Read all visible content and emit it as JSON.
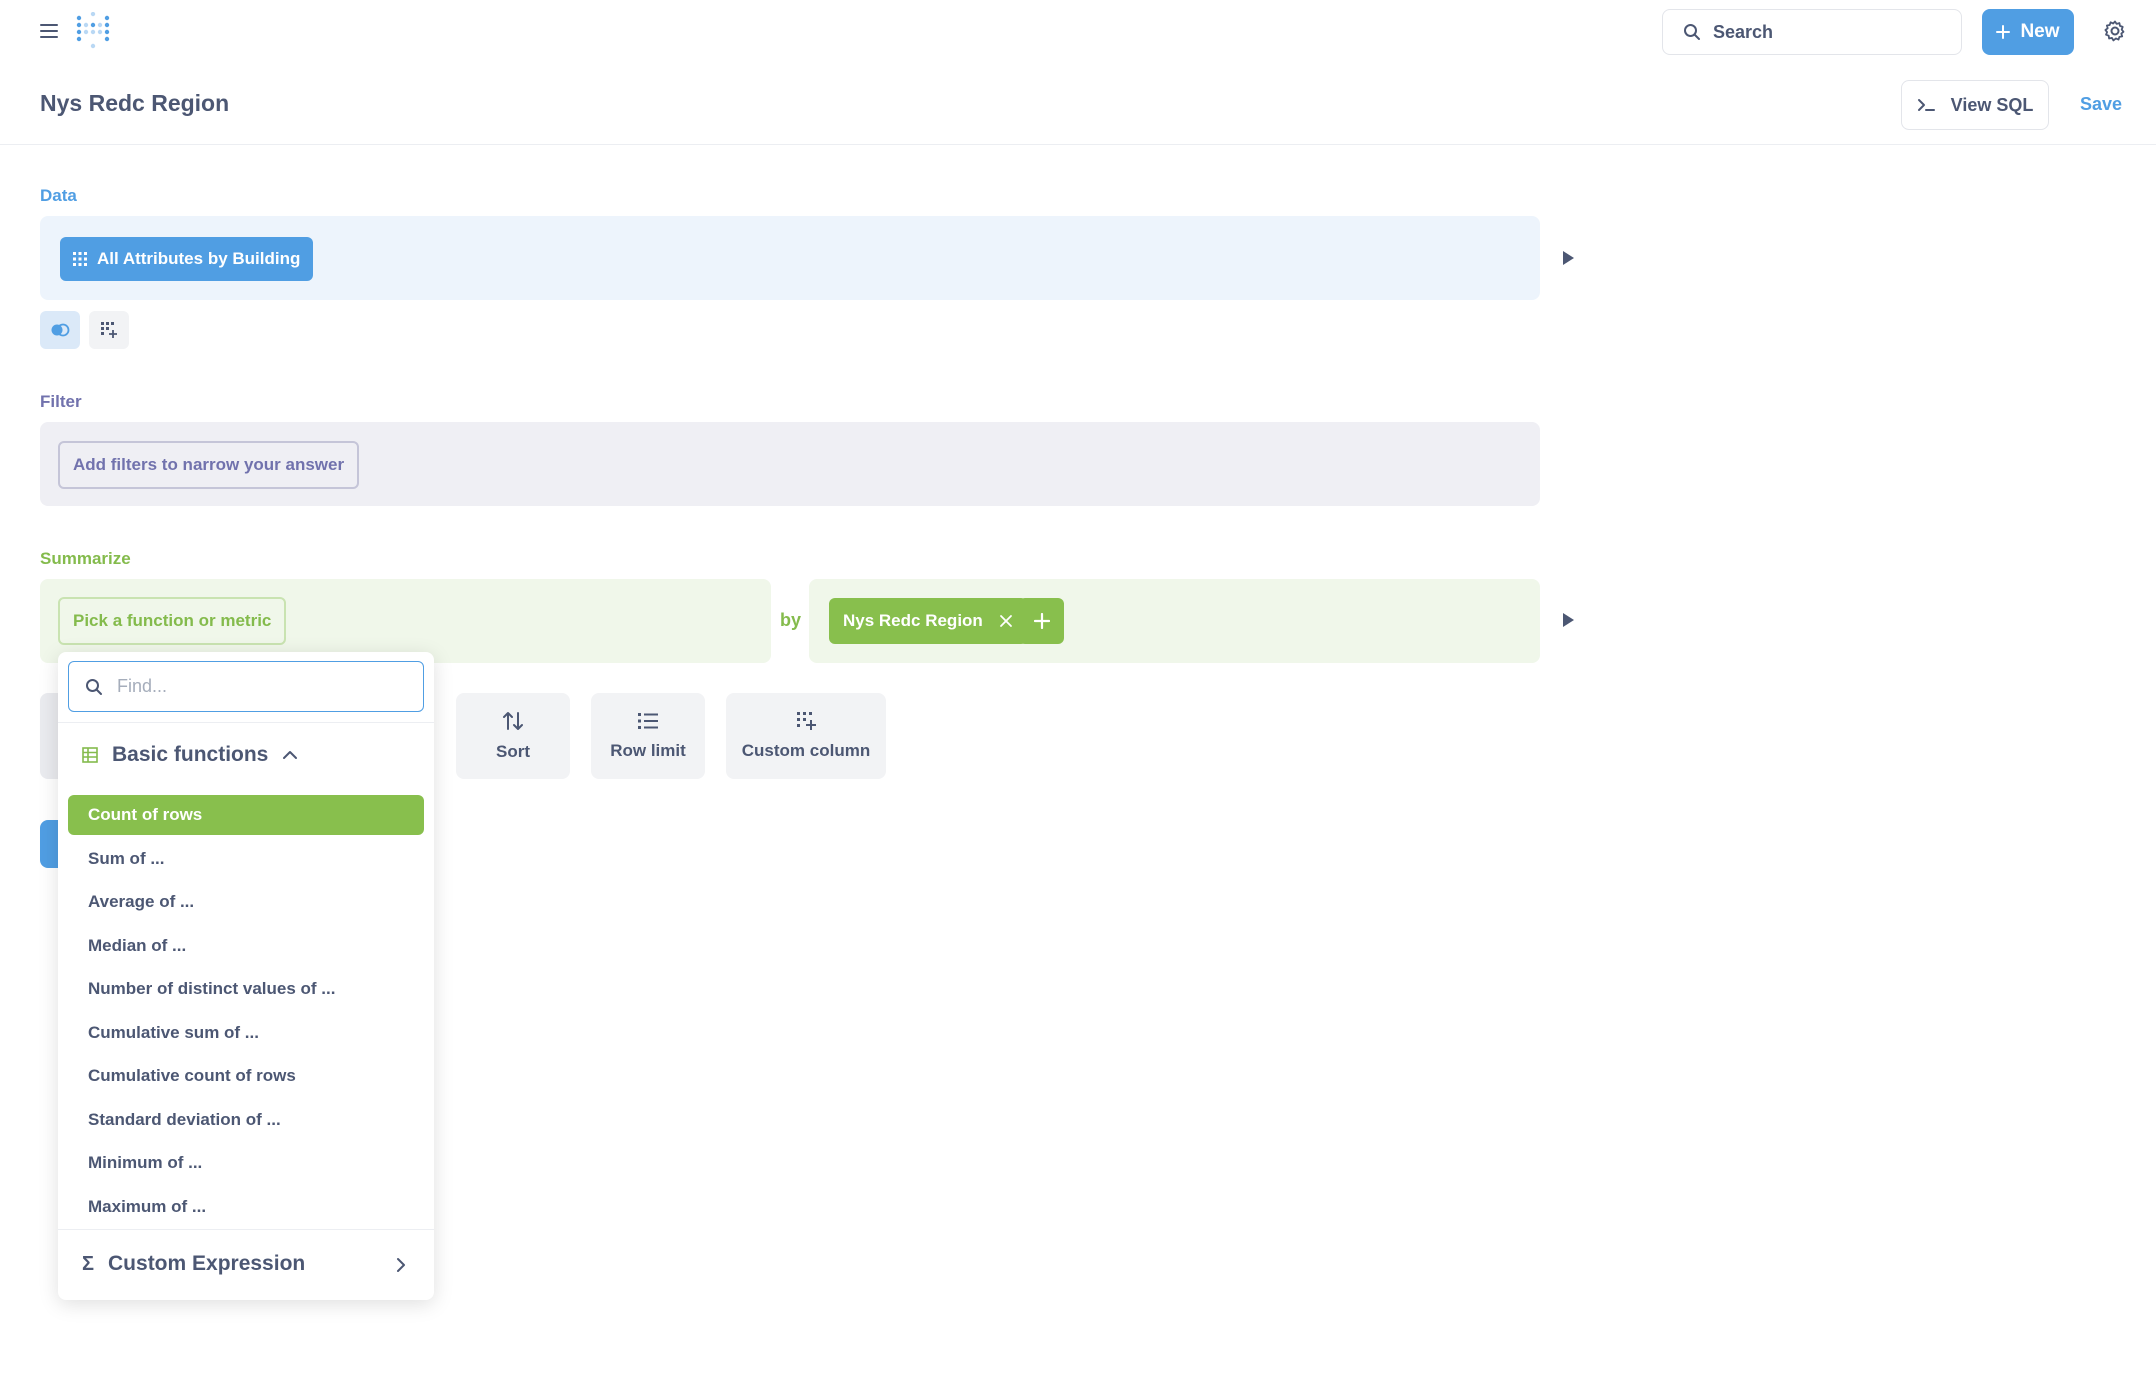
{
  "nav": {
    "search_label": "Search",
    "new_label": "New"
  },
  "header": {
    "title": "Nys Redc Region",
    "view_sql_label": "View SQL",
    "save_label": "Save"
  },
  "data_section": {
    "label": "Data",
    "table_name": "All Attributes by Building"
  },
  "filter_section": {
    "label": "Filter",
    "placeholder": "Add filters to narrow your answer"
  },
  "summarize_section": {
    "label": "Summarize",
    "metric_placeholder": "Pick a function or metric",
    "by_label": "by",
    "breakout": "Nys Redc Region"
  },
  "steps": {
    "sort": "Sort",
    "row_limit": "Row limit",
    "custom_column": "Custom column"
  },
  "popover": {
    "find_placeholder": "Find...",
    "group_label": "Basic functions",
    "functions": [
      "Count of rows",
      "Sum of ...",
      "Average of ...",
      "Median of ...",
      "Number of distinct values of ...",
      "Cumulative sum of ...",
      "Cumulative count of rows",
      "Standard deviation of ...",
      "Minimum of ...",
      "Maximum of ..."
    ],
    "custom_expression": "Custom Expression"
  },
  "colors": {
    "brand": "#509ee3",
    "summarize": "#88bf4d",
    "filter": "#7172ad",
    "text": "#4c5773"
  }
}
